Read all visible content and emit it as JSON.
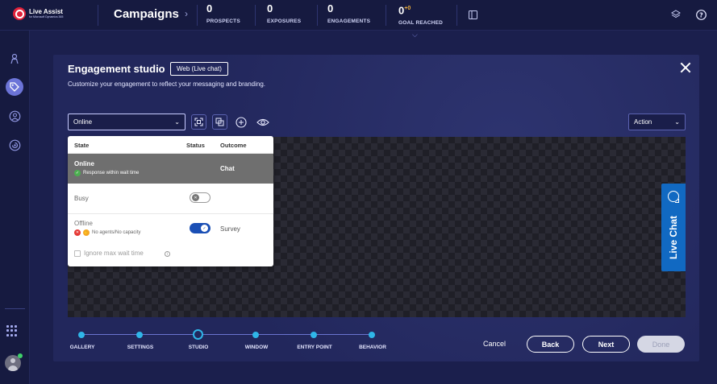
{
  "brand": {
    "name": "Live Assist",
    "tagline": "for Microsoft Dynamics 365"
  },
  "header": {
    "title": "Campaigns",
    "stats": [
      {
        "value": "0",
        "label": "PROSPECTS"
      },
      {
        "value": "0",
        "label": "EXPOSURES"
      },
      {
        "value": "0",
        "label": "ENGAGEMENTS"
      },
      {
        "value": "0",
        "delta": "+0",
        "label": "GOAL REACHED"
      }
    ]
  },
  "modal": {
    "title": "Engagement studio",
    "tag": "Web (Live chat)",
    "subtitle": "Customize your engagement to reflect your messaging and branding.",
    "state_select": {
      "value": "Online"
    },
    "action_select": {
      "value": "Action"
    },
    "state_popup": {
      "headers": {
        "state": "State",
        "status": "Status",
        "outcome": "Outcome"
      },
      "rows": [
        {
          "name": "Online",
          "sub": "Response within wait time",
          "outcome": "Chat",
          "selected": true
        },
        {
          "name": "Busy",
          "sub": "",
          "outcome": "",
          "toggle": "off"
        },
        {
          "name": "Offline",
          "sub": "No agents/No capacity",
          "outcome": "Survey",
          "toggle": "on"
        }
      ],
      "ignore_label": "Ignore max wait time"
    },
    "preview": {
      "live_chat_label": "Live Chat"
    },
    "stepper": {
      "steps": [
        "GALLERY",
        "SETTINGS",
        "STUDIO",
        "WINDOW",
        "ENTRY POINT",
        "BEHAVIOR"
      ],
      "current": "STUDIO"
    },
    "buttons": {
      "cancel": "Cancel",
      "back": "Back",
      "next": "Next",
      "done": "Done"
    }
  },
  "colors": {
    "accent": "#2fb6e8",
    "brand_red": "#e0213a",
    "chat_blue": "#1169c2"
  }
}
